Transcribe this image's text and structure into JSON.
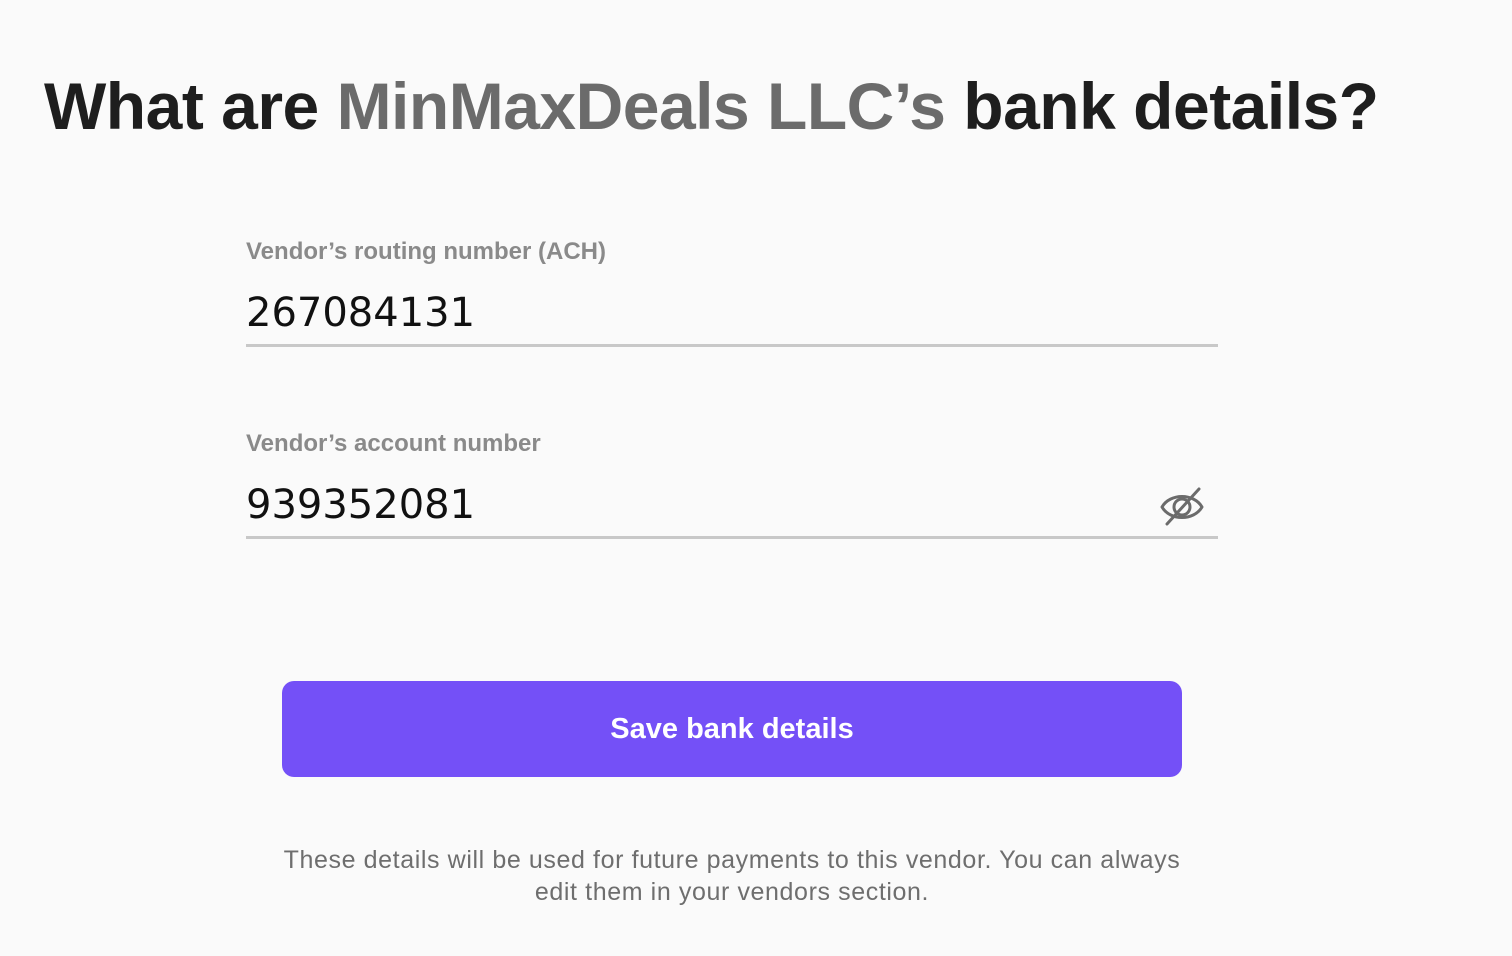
{
  "heading": {
    "prefix": "What are ",
    "vendor_name": "MinMaxDeals LLC’s",
    "suffix": " bank details?"
  },
  "routing": {
    "label": "Vendor’s routing number (ACH)",
    "value": "267084131"
  },
  "account": {
    "label": "Vendor’s account number",
    "value": "939352081",
    "toggle_icon": "eye-off-icon"
  },
  "save_button": {
    "label": "Save bank details",
    "color": "#7450f7"
  },
  "footnote": "These details will be used for future payments to this vendor. You can always edit them in your vendors section."
}
